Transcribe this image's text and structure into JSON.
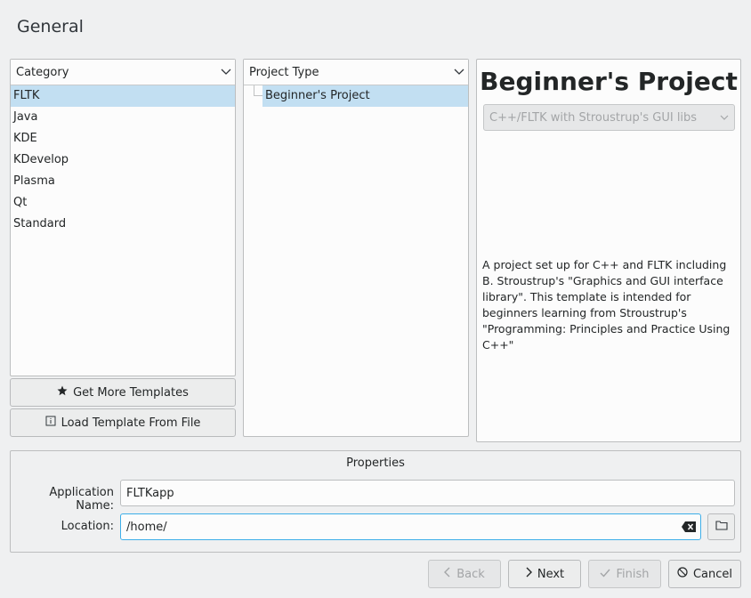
{
  "page": {
    "title": "General"
  },
  "category": {
    "header": "Category",
    "items": [
      "FLTK",
      "Java",
      "KDE",
      "KDevelop",
      "Plasma",
      "Qt",
      "Standard"
    ],
    "selected_index": 0
  },
  "project_type": {
    "header": "Project Type",
    "items": [
      "Beginner's Project"
    ]
  },
  "buttons": {
    "get_more": "Get More Templates",
    "load_from_file": "Load Template From File"
  },
  "description": {
    "title": "Beginner's Project",
    "variant_combo": "C++/FLTK with Stroustrup's GUI libs",
    "text": "A project set up for C++ and FLTK including B. Stroustrup's \"Graphics and GUI interface library\". This template is intended for beginners learning from Stroustrup's \"Programming: Principles and Practice Using C++\""
  },
  "properties": {
    "title": "Properties",
    "app_name_label": "Application Name:",
    "app_name_value": "FLTKapp",
    "location_label": "Location:",
    "location_value": "/home/"
  },
  "footer": {
    "back": "Back",
    "next": "Next",
    "finish": "Finish",
    "cancel": "Cancel"
  },
  "colors": {
    "selection": "#c2dff2",
    "focus": "#3daee9",
    "window_bg": "#eff0f1"
  }
}
